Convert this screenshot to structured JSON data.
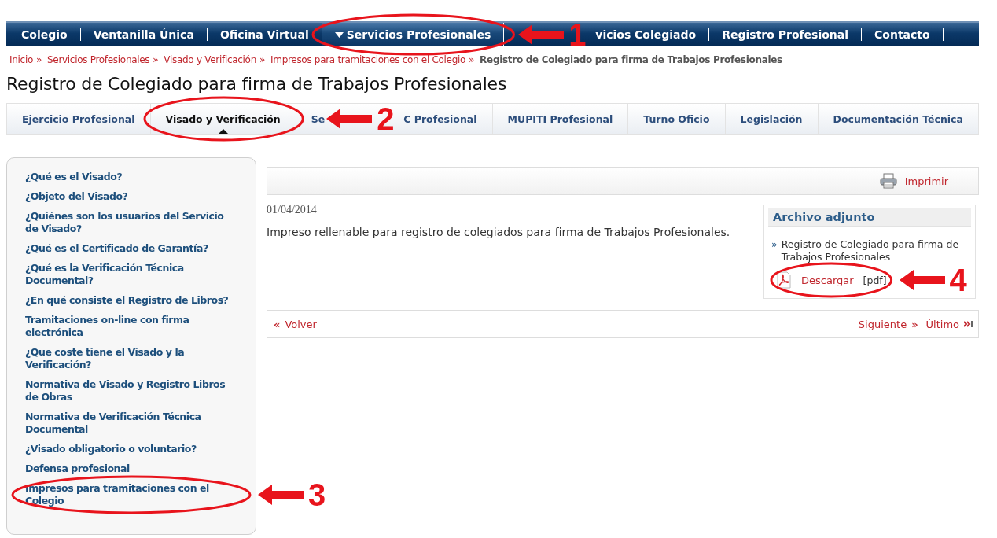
{
  "top_nav": [
    {
      "label": "Colegio",
      "selected": false,
      "covered": false
    },
    {
      "label": "Ventanilla Única",
      "selected": false,
      "covered": false
    },
    {
      "label": "Oficina Virtual",
      "selected": false,
      "covered": false
    },
    {
      "label": "Servicios Profesionales",
      "selected": true,
      "covered": false
    },
    {
      "label": "vicios Colegiado",
      "selected": false,
      "covered": true
    },
    {
      "label": "Registro Profesional",
      "selected": false,
      "covered": false
    },
    {
      "label": "Contacto",
      "selected": false,
      "covered": false
    }
  ],
  "breadcrumb": {
    "links": [
      {
        "label": "Inicio",
        "separator": "»"
      },
      {
        "label": "Servicios Profesionales",
        "separator": "»"
      },
      {
        "label": "Visado y Verificación",
        "separator": "»"
      },
      {
        "label": "Impresos para tramitaciones con el Colegio",
        "separator": "»"
      }
    ],
    "current": "Registro de Colegiado para firma de Trabajos Profesionales"
  },
  "page_title": "Registro de Colegiado para firma de Trabajos Profesionales",
  "sub_tabs": [
    {
      "label_parts": [
        "Ejercicio Profesional"
      ],
      "selected": false
    },
    {
      "label_parts": [
        "Visado y Verificación"
      ],
      "selected": true
    },
    {
      "label_parts": [
        "Se",
        "C Profesional"
      ],
      "selected": false
    },
    {
      "label_parts": [
        "MUPITI Profesional"
      ],
      "selected": false
    },
    {
      "label_parts": [
        "Turno Oficio"
      ],
      "selected": false
    },
    {
      "label_parts": [
        "Legislación"
      ],
      "selected": false
    },
    {
      "label_parts": [
        "Documentación Técnica"
      ],
      "selected": false
    }
  ],
  "sidebar": {
    "items": [
      "¿Qué es el Visado?",
      "¿Objeto del Visado?",
      "¿Quiénes son los usuarios del Servicio de Visado?",
      "¿Qué es el Certificado de Garantía?",
      "¿Qué es la Verificación Técnica Documental?",
      "¿En qué consiste el Registro de Libros?",
      "Tramitaciones on-line con firma electrónica",
      "¿Que coste tiene el Visado y la Verificación?",
      "Normativa de Visado y Registro Libros de Obras",
      "Normativa de Verificación Técnica Documental",
      "¿Visado obligatorio o voluntario?",
      "Defensa profesional",
      "Impresos para tramitaciones con el Colegio"
    ]
  },
  "toolbar": {
    "print_label": "Imprimir"
  },
  "article": {
    "date": "01/04/2014",
    "text": "Impreso rellenable para registro de colegiados para firma de Trabajos Profesionales."
  },
  "attachment": {
    "title": "Archivo adjunto",
    "bullet": "»",
    "file_name": "Registro de Colegiado para firma de Trabajos Profesionales",
    "download_label": "Descargar",
    "format": "[pdf]"
  },
  "pager": {
    "back_mark": "«",
    "back": "Volver",
    "next": "Siguiente",
    "next_mark": "»",
    "last": "Último"
  },
  "annotations": [
    {
      "number": "1"
    },
    {
      "number": "2"
    },
    {
      "number": "3"
    },
    {
      "number": "4"
    }
  ]
}
